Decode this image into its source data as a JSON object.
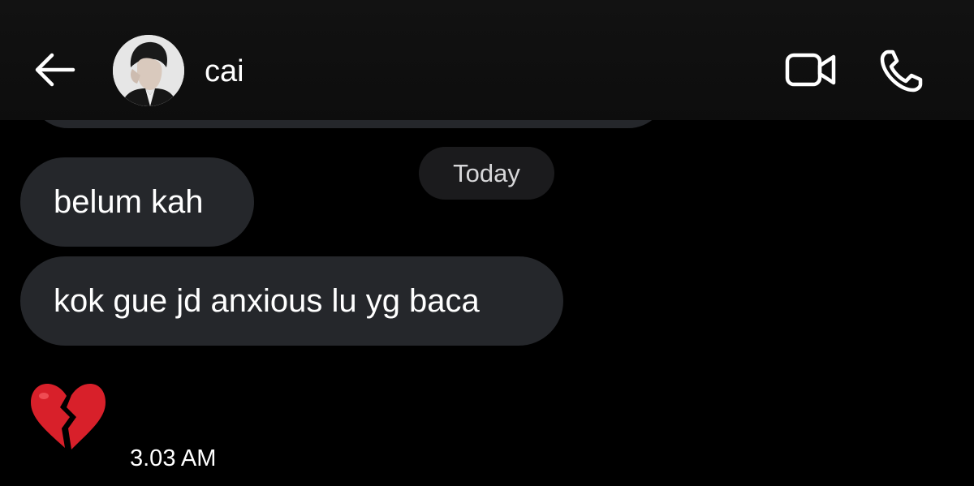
{
  "header": {
    "contact_name": "cai",
    "avatar_icon": "person-photo-avatar",
    "back_icon": "arrow-left-icon",
    "video_icon": "video-camera-icon",
    "call_icon": "phone-icon"
  },
  "chat": {
    "date_separator": "Today",
    "messages": [
      {
        "text": "belum kah"
      },
      {
        "text": "kok gue jd anxious lu yg baca"
      }
    ],
    "reaction_emoji": "💔",
    "reaction_icon": "broken-heart-icon",
    "timestamp": "3.03 AM"
  },
  "colors": {
    "background": "#000000",
    "header": "#121212",
    "bubble": "#25272b",
    "date_chip": "#1b1b1d",
    "reaction": "#d8202a"
  }
}
